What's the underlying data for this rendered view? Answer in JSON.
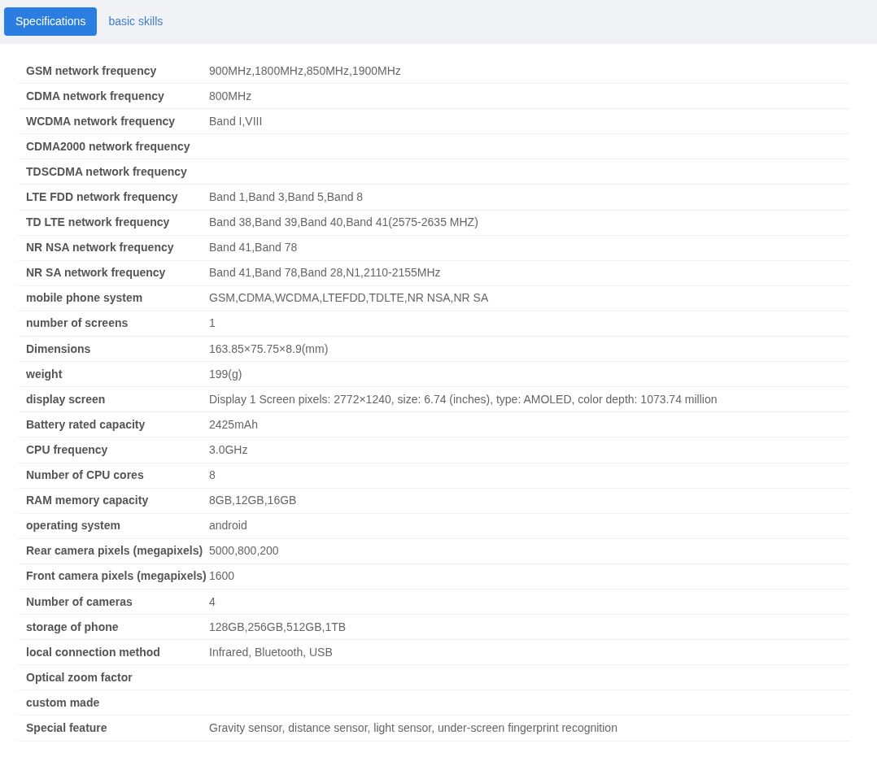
{
  "tabs": [
    {
      "label": "Specifications",
      "selected": true
    },
    {
      "label": "basic skills",
      "selected": false
    }
  ],
  "specs": [
    {
      "label": "GSM network frequency",
      "value": "900MHz,1800MHz,850MHz,1900MHz"
    },
    {
      "label": "CDMA network frequency",
      "value": "800MHz"
    },
    {
      "label": "WCDMA network frequency",
      "value": "Band I,VIII"
    },
    {
      "label": "CDMA2000 network frequency"
    },
    {
      "label": "TDSCDMA network frequency"
    },
    {
      "label": "LTE FDD network frequency",
      "value": "Band 1,Band 3,Band 5,Band 8"
    },
    {
      "label": "TD LTE network frequency",
      "value": "Band 38,Band 39,Band 40,Band 41(2575-2635 MHZ)"
    },
    {
      "label": "NR NSA network frequency",
      "value": "Band 41,Band 78"
    },
    {
      "label": "NR SA network frequency",
      "value": "Band 41,Band 78,Band 28,N1,2110-2155MHz"
    },
    {
      "label": "mobile phone system",
      "value": "GSM,CDMA,WCDMA,LTEFDD,TDLTE,NR NSA,NR SA"
    },
    {
      "label": "number of screens",
      "value": "1"
    },
    {
      "label": "Dimensions",
      "value": "163.85×75.75×8.9(mm)"
    },
    {
      "label": "weight",
      "value": "199(g)"
    },
    {
      "label": "display screen",
      "value": "Display 1 Screen pixels: 2772×1240, size: 6.74 (inches), type: AMOLED, color depth: 1073.74 million"
    },
    {
      "label": "Battery rated capacity",
      "value": "2425mAh"
    },
    {
      "label": "CPU frequency",
      "value": "3.0GHz"
    },
    {
      "label": "Number of CPU cores",
      "value": "8"
    },
    {
      "label": "RAM memory capacity",
      "value": "8GB,12GB,16GB"
    },
    {
      "label": "operating system",
      "value": "android"
    },
    {
      "label": "Rear camera pixels (megapixels)",
      "value": "5000,800,200"
    },
    {
      "label": "Front camera pixels (megapixels)",
      "value": "1600"
    },
    {
      "label": "Number of cameras",
      "value": "4"
    },
    {
      "label": "storage of phone",
      "value": "128GB,256GB,512GB,1TB"
    },
    {
      "label": "local connection method",
      "value": "Infrared, Bluetooth, USB"
    },
    {
      "label": "Optical zoom factor"
    },
    {
      "label": "custom made"
    },
    {
      "label": "Special feature",
      "value": "Gravity sensor, distance sensor, light sensor, under-screen fingerprint recognition"
    }
  ]
}
